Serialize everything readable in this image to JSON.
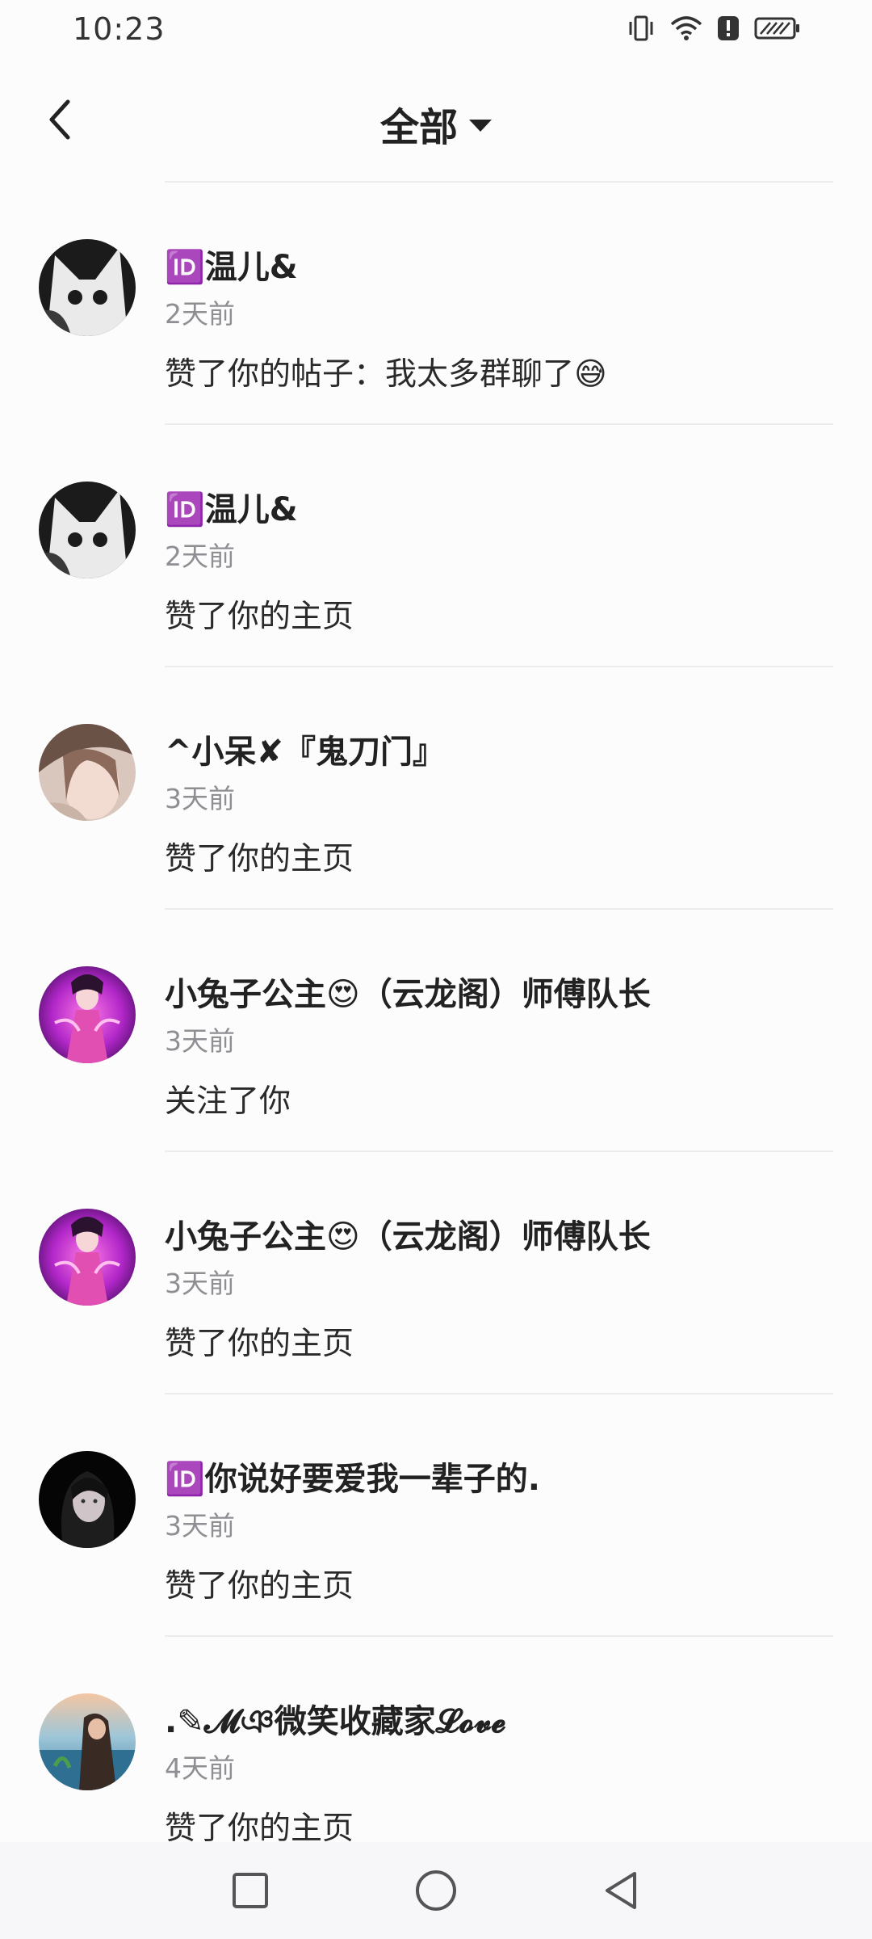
{
  "status_bar": {
    "time": "10:23",
    "icons": [
      "vibrate-icon",
      "wifi-icon",
      "alert-icon",
      "battery-charging-icon"
    ]
  },
  "header": {
    "title": "全部",
    "back_icon": "back-arrow-icon",
    "dropdown_icon": "caret-down-icon"
  },
  "notifications": [
    {
      "name": "🆔温儿&",
      "time": "2天前",
      "action": "赞了你的帖子：我太多群聊了😅",
      "avatar": "fox-avatar"
    },
    {
      "name": "🆔温儿&",
      "time": "2天前",
      "action": "赞了你的主页",
      "avatar": "fox-avatar"
    },
    {
      "name": "^小呆✘『鬼刀门』",
      "time": "3天前",
      "action": "赞了你的主页",
      "avatar": "girl-photo-avatar"
    },
    {
      "name": "小兔子公主😍（云龙阁）师傅队长",
      "time": "3天前",
      "action": "关注了你",
      "avatar": "anime-princess-avatar"
    },
    {
      "name": "小兔子公主😍（云龙阁）师傅队长",
      "time": "3天前",
      "action": "赞了你的主页",
      "avatar": "anime-princess-avatar"
    },
    {
      "name": "🆔你说好要爱我一辈子的.",
      "time": "3天前",
      "action": "赞了你的主页",
      "avatar": "dark-girl-avatar"
    },
    {
      "name": ".✎𝓜ঞ微笑收藏家𝓛𝓸𝓿𝓮",
      "time": "4天前",
      "action": "赞了你的主页",
      "avatar": "beach-avatar"
    }
  ],
  "nav_bar": {
    "recents_icon": "square-icon",
    "home_icon": "circle-icon",
    "back_icon": "triangle-back-icon"
  }
}
